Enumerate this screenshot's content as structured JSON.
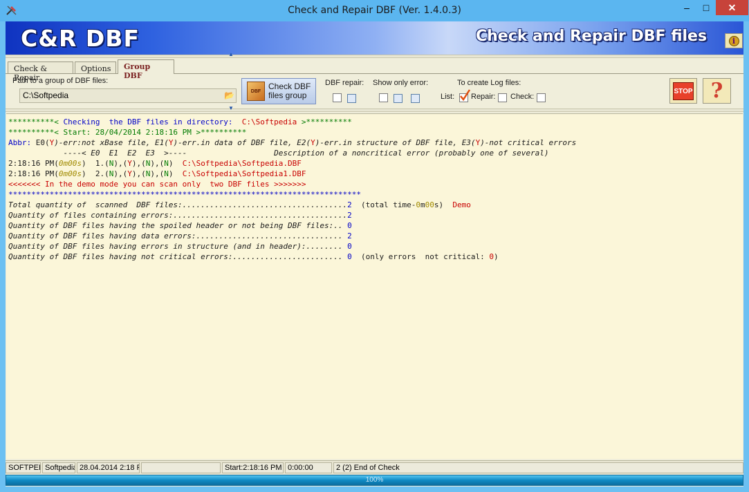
{
  "window": {
    "title": "Check and Repair DBF  (Ver. 1.4.0.3)"
  },
  "banner": {
    "logo": "C&R DBF",
    "title": "Check and Repair DBF files",
    "info_label": "i"
  },
  "tabs": [
    {
      "label": "Check & Repair",
      "selected": false
    },
    {
      "label": "Options",
      "selected": false
    },
    {
      "label": "Group DBF",
      "selected": true
    }
  ],
  "panel": {
    "path_label": "Path to a group of DBF files:",
    "path_value": "C:\\Softpedia",
    "check_button": "Check DBF files group",
    "dbf_repair_label": "DBF repair:",
    "show_error_label": "Show only error:",
    "log_label": "To create  Log  files:",
    "list_label": "List:",
    "repair_label": "Repair:",
    "check_label": "Check:",
    "list_checked": true,
    "stop_label": "STOP",
    "help_label": "?"
  },
  "log": [
    [
      {
        "t": "**********< ",
        "c": "g"
      },
      {
        "t": "Checking  the DBF files in directory:  ",
        "c": "b"
      },
      {
        "t": "C:\\Softpedia",
        "c": "r"
      },
      {
        "t": " >**********",
        "c": "g"
      }
    ],
    [
      {
        "t": "**********< Start: 28/04/2014 2:18:16 PM >**********",
        "c": "g"
      }
    ],
    [
      {
        "t": "Abbr: ",
        "c": "b"
      },
      {
        "t": "E0(",
        "c": "k"
      },
      {
        "t": "Y",
        "c": "r"
      },
      {
        "t": ")-err:not xBase file, E1(",
        "c": "k i"
      },
      {
        "t": "Y",
        "c": "r"
      },
      {
        "t": ")-err.in data of DBF file, E2(",
        "c": "k i"
      },
      {
        "t": "Y",
        "c": "r"
      },
      {
        "t": ")-err.in structure of DBF file, E3(",
        "c": "k i"
      },
      {
        "t": "Y",
        "c": "r"
      },
      {
        "t": ")-not critical errors",
        "c": "k i"
      }
    ],
    [
      {
        "t": "            ----< E0  E1  E2  E3  >----                   Description of a noncritical error (probably one of several)",
        "c": "k i"
      }
    ],
    [
      {
        "t": "2:18:16 PM(",
        "c": "k"
      },
      {
        "t": "0m00s",
        "c": "y i"
      },
      {
        "t": ")  1.(",
        "c": "k"
      },
      {
        "t": "N",
        "c": "g"
      },
      {
        "t": "),(",
        "c": "k"
      },
      {
        "t": "Y",
        "c": "r"
      },
      {
        "t": "),(",
        "c": "k"
      },
      {
        "t": "N",
        "c": "g"
      },
      {
        "t": "),(",
        "c": "k"
      },
      {
        "t": "N",
        "c": "g"
      },
      {
        "t": ")  ",
        "c": "k"
      },
      {
        "t": "C:\\Softpedia\\Softpedia.DBF",
        "c": "r"
      }
    ],
    [
      {
        "t": "2:18:16 PM(",
        "c": "k"
      },
      {
        "t": "0m00s",
        "c": "y i"
      },
      {
        "t": ")  2.(",
        "c": "k"
      },
      {
        "t": "N",
        "c": "g"
      },
      {
        "t": "),(",
        "c": "k"
      },
      {
        "t": "Y",
        "c": "r"
      },
      {
        "t": "),(",
        "c": "k"
      },
      {
        "t": "N",
        "c": "g"
      },
      {
        "t": "),(",
        "c": "k"
      },
      {
        "t": "N",
        "c": "g"
      },
      {
        "t": ")  ",
        "c": "k"
      },
      {
        "t": "C:\\Softpedia\\Softpedia1.DBF",
        "c": "r"
      }
    ],
    [
      {
        "t": "<<<<<<< In the demo mode you can scan only  two DBF files >>>>>>>",
        "c": "r"
      }
    ],
    [
      {
        "t": "*****************************************************************************",
        "c": "b"
      }
    ],
    [
      {
        "t": "Total quantity of  scanned  DBF files:....................................",
        "c": "k i"
      },
      {
        "t": "2",
        "c": "b"
      },
      {
        "t": "  (total time-",
        "c": "k"
      },
      {
        "t": "0",
        "c": "y"
      },
      {
        "t": "m",
        "c": "k"
      },
      {
        "t": "00",
        "c": "y"
      },
      {
        "t": "s)  ",
        "c": "k"
      },
      {
        "t": "Demo",
        "c": "r"
      }
    ],
    [
      {
        "t": "Quantity of files containing errors:......................................",
        "c": "k i"
      },
      {
        "t": "2",
        "c": "b"
      }
    ],
    [
      {
        "t": "Quantity of DBF files having the spoiled header or not being DBF files:.. ",
        "c": "k i"
      },
      {
        "t": "0",
        "c": "b"
      }
    ],
    [
      {
        "t": "Quantity of DBF files having data errors:................................ ",
        "c": "k i"
      },
      {
        "t": "2",
        "c": "b"
      }
    ],
    [
      {
        "t": "Quantity of DBF files having errors in structure (and in header):........ ",
        "c": "k i"
      },
      {
        "t": "0",
        "c": "b"
      }
    ],
    [
      {
        "t": "Quantity of DBF files having not critical errors:........................ ",
        "c": "k i"
      },
      {
        "t": "0",
        "c": "b"
      },
      {
        "t": "  (only errors  not critical: ",
        "c": "k"
      },
      {
        "t": "0",
        "c": "r"
      },
      {
        "t": ")",
        "c": "k"
      }
    ]
  ],
  "status": {
    "c1": "SOFTPED",
    "c2": "Softpedia",
    "c3": "28.04.2014 2:18 F",
    "c4": "",
    "c5": "Start:2:18:16 PM",
    "c6": "0:00:00",
    "c7": "2 (2)  End of Check"
  },
  "progress": {
    "value": 1.0,
    "label": "100%"
  }
}
